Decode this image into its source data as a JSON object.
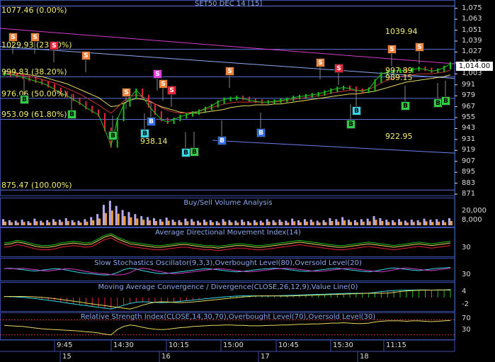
{
  "header": {
    "title": "SET50 DEC 14   [15]"
  },
  "colors": {
    "background": "#000000",
    "grid": "#2a3f8f",
    "price": "#1bc41b",
    "fib": "#f2ee6a",
    "ma_red": "#c8323a",
    "ma_yellow": "#e8d860",
    "trend_magenta": "#d63cc8",
    "panel_title": "#8aa8f0"
  },
  "fib_levels": [
    {
      "label": "1077.46 (0.00%)",
      "value": 1077.46
    },
    {
      "label": "1029.93 (23.60%)",
      "value": 1029.93
    },
    {
      "label": "999.83 (38.20%)",
      "value": 999.83
    },
    {
      "label": "976.06 (50.00%)",
      "value": 976.06
    },
    {
      "label": "953.09 (61.80%)",
      "value": 953.09
    },
    {
      "label": "875.47 (100.00%)",
      "value": 875.47
    }
  ],
  "annotations": {
    "high_label": "1039.94",
    "low_label": "922.95",
    "low_point": "938.14",
    "level_a": "997.89",
    "level_b": "989.15"
  },
  "last_price": "1,014.00",
  "y_axis_ticks": [
    "1,075",
    "1,063",
    "1,051",
    "1,039",
    "1,027",
    "1,015",
    "1,003",
    "991",
    "979",
    "967",
    "955",
    "943",
    "931",
    "919",
    "907",
    "895",
    "883",
    "871"
  ],
  "volume_ticks": [
    "20,000",
    "8,000"
  ],
  "adx_ticks": [
    "30"
  ],
  "stoch_ticks": [
    "30"
  ],
  "macd_ticks": [
    "4",
    "-2"
  ],
  "rsi_ticks": [
    "70",
    "30"
  ],
  "panels": {
    "volume": "Buy/Sell Volume Analysis",
    "adx": "Average Directional Movement Index(14)",
    "stoch": "Slow Stochastics Oscillator(9,3,3),Overbought Level(80),Oversold Level(20)",
    "macd": "Moving Average Convergence / Divergence(CLOSE,26,12,9),Value Line(0)",
    "rsi": "Relative Strength Index(CLOSE,14,30,70),Overbought Level(70),Oversold Level(30)"
  },
  "x_axis": {
    "times": [
      "9:45",
      "14:30",
      "10:15",
      "15:00",
      "10:45",
      "15:30",
      "11:15"
    ],
    "days": [
      "15",
      "16",
      "17",
      "18"
    ]
  },
  "signals": [
    {
      "t": "S",
      "s": "orange"
    },
    {
      "t": "S",
      "s": "orange"
    },
    {
      "t": "S",
      "s": "red"
    },
    {
      "t": "S",
      "s": "orange"
    },
    {
      "t": "S",
      "s": "orange"
    },
    {
      "t": "S",
      "s": "pink"
    },
    {
      "t": "S",
      "s": "orange"
    },
    {
      "t": "S",
      "s": "red"
    },
    {
      "t": "S",
      "s": "orange"
    },
    {
      "t": "S",
      "s": "orange"
    },
    {
      "t": "S",
      "s": "red"
    },
    {
      "t": "S",
      "s": "orange"
    },
    {
      "t": "S",
      "s": "orange"
    },
    {
      "t": "B",
      "s": "green"
    },
    {
      "t": "B",
      "s": "green"
    },
    {
      "t": "B",
      "s": "green"
    },
    {
      "t": "B",
      "s": "cyan"
    },
    {
      "t": "B",
      "s": "blue"
    },
    {
      "t": "B",
      "s": "blue"
    },
    {
      "t": "B",
      "s": "cyan"
    },
    {
      "t": "B",
      "s": "green"
    },
    {
      "t": "B",
      "s": "blue"
    },
    {
      "t": "B",
      "s": "green"
    },
    {
      "t": "B",
      "s": "cyan"
    },
    {
      "t": "B",
      "s": "green"
    },
    {
      "t": "B",
      "s": "green"
    },
    {
      "t": "B",
      "s": "green"
    },
    {
      "t": "B",
      "s": "cyan"
    }
  ],
  "chart_data": {
    "type": "line",
    "price": {
      "ylim": [
        871,
        1081
      ],
      "close": [
        1003,
        1002,
        1001,
        999,
        997,
        995,
        993,
        990,
        986,
        982,
        979,
        975,
        971,
        966,
        962,
        958,
        942,
        924,
        953,
        969,
        977,
        985,
        978,
        968,
        960,
        953,
        950,
        953,
        956,
        958,
        960,
        962,
        965,
        968,
        972,
        975,
        976,
        977,
        976,
        974,
        973,
        972,
        972,
        973,
        974,
        975,
        977,
        978,
        979,
        980,
        981,
        983,
        985,
        987,
        988,
        987,
        985,
        984,
        986,
        995,
        1003,
        1005,
        1006,
        1007,
        1006,
        1008,
        1009,
        1008,
        1006,
        1007,
        1010,
        1014
      ],
      "ma_red": [
        1004,
        1003,
        1002,
        1001,
        1000,
        999,
        997,
        995,
        993,
        990,
        987,
        984,
        981,
        977,
        973,
        969,
        964,
        960,
        966,
        973,
        978,
        980,
        978,
        974,
        970,
        966,
        963,
        961,
        960,
        960,
        961,
        962,
        964,
        966,
        968,
        970,
        971,
        972,
        972,
        972,
        972,
        972,
        972,
        972,
        973,
        974,
        975,
        976,
        977,
        978,
        979,
        980,
        982,
        983,
        984,
        985,
        985,
        985,
        986,
        989,
        993,
        996,
        998,
        1000,
        1001,
        1002,
        1003,
        1003,
        1003,
        1004,
        1005,
        1007
      ],
      "ma_yellow": [
        1006,
        1005,
        1004,
        1003,
        1002,
        1001,
        1000,
        998,
        996,
        994,
        992,
        989,
        986,
        983,
        980,
        977,
        972,
        967,
        968,
        971,
        974,
        976,
        975,
        973,
        970,
        967,
        965,
        963,
        961,
        960,
        960,
        960,
        961,
        962,
        963,
        964,
        966,
        967,
        968,
        968,
        969,
        969,
        969,
        970,
        970,
        971,
        972,
        973,
        974,
        975,
        976,
        977,
        978,
        979,
        980,
        981,
        981,
        982,
        983,
        984,
        986,
        988,
        990,
        992,
        994,
        995,
        996,
        997,
        998,
        999,
        1000,
        1002
      ]
    },
    "volume": [
      12,
      10,
      9,
      11,
      8,
      13,
      9,
      10,
      12,
      11,
      14,
      10,
      9,
      12,
      16,
      22,
      40,
      48,
      38,
      30,
      26,
      22,
      18,
      16,
      14,
      12,
      15,
      11,
      10,
      13,
      12,
      9,
      11,
      10,
      8,
      12,
      10,
      9,
      11,
      8,
      10,
      9,
      12,
      10,
      11,
      9,
      13,
      10,
      12,
      11,
      9,
      10,
      14,
      12,
      16,
      11,
      10,
      12,
      13,
      18,
      14,
      11,
      10,
      12,
      9,
      11,
      10,
      13,
      11,
      12,
      10,
      14
    ],
    "adx": [
      33,
      34,
      36,
      35,
      33,
      31,
      30,
      30,
      31,
      33,
      34,
      35,
      34,
      33,
      34,
      38,
      42,
      44,
      40,
      37,
      34,
      33,
      32,
      31,
      30,
      30,
      31,
      32,
      33,
      33,
      32,
      31,
      30,
      30,
      29,
      30,
      31,
      32,
      32,
      31,
      30,
      30,
      31,
      32,
      33,
      34,
      35,
      36,
      35,
      34,
      33,
      32,
      31,
      30,
      30,
      31,
      32,
      33,
      34,
      33,
      32,
      31,
      30,
      31,
      32,
      33,
      34,
      33,
      32,
      33,
      34,
      35
    ],
    "stoch": [
      60,
      62,
      58,
      55,
      50,
      48,
      52,
      56,
      60,
      58,
      52,
      46,
      40,
      36,
      34,
      30,
      28,
      30,
      40,
      55,
      62,
      58,
      50,
      44,
      38,
      34,
      36,
      40,
      44,
      48,
      52,
      56,
      60,
      58,
      54,
      50,
      46,
      44,
      46,
      50,
      54,
      58,
      60,
      62,
      60,
      56,
      52,
      48,
      46,
      48,
      52,
      56,
      60,
      62,
      58,
      54,
      50,
      46,
      44,
      48,
      54,
      60,
      64,
      60,
      56,
      52,
      50,
      54,
      58,
      62,
      64,
      66
    ],
    "macd": [
      0.5,
      0.4,
      0.3,
      0.1,
      -0.2,
      -0.5,
      -0.9,
      -1.3,
      -1.7,
      -2.1,
      -2.6,
      -3.0,
      -3.4,
      -3.8,
      -4.2,
      -4.6,
      -5.0,
      -5.4,
      -4.6,
      -3.6,
      -2.8,
      -2.2,
      -2.0,
      -2.1,
      -2.3,
      -2.4,
      -2.3,
      -2.1,
      -1.8,
      -1.5,
      -1.2,
      -0.9,
      -0.6,
      -0.3,
      0.0,
      0.3,
      0.5,
      0.7,
      0.8,
      0.8,
      0.8,
      0.7,
      0.7,
      0.8,
      0.9,
      1.0,
      1.1,
      1.2,
      1.3,
      1.4,
      1.5,
      1.6,
      1.7,
      1.8,
      1.9,
      2.0,
      2.0,
      2.0,
      2.1,
      2.4,
      2.8,
      3.1,
      3.3,
      3.4,
      3.5,
      3.5,
      3.6,
      3.6,
      3.5,
      3.5,
      3.6,
      3.8
    ],
    "rsi": [
      55,
      54,
      53,
      52,
      50,
      48,
      46,
      45,
      44,
      43,
      42,
      41,
      40,
      38,
      37,
      35,
      32,
      30,
      44,
      52,
      56,
      54,
      50,
      47,
      45,
      44,
      45,
      47,
      49,
      50,
      52,
      53,
      54,
      55,
      55,
      56,
      56,
      55,
      55,
      54,
      54,
      54,
      55,
      55,
      56,
      56,
      57,
      58,
      58,
      59,
      59,
      60,
      61,
      61,
      62,
      61,
      60,
      60,
      61,
      64,
      66,
      67,
      67,
      67,
      66,
      67,
      67,
      66,
      65,
      66,
      67,
      68
    ]
  }
}
